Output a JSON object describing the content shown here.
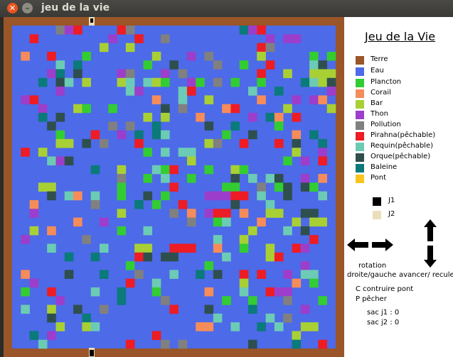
{
  "window": {
    "title": "jeu de la vie",
    "close_icon": "close-icon",
    "minimize_icon": "minimize-icon"
  },
  "panel": {
    "heading": "Jeu de la Vie",
    "legend": [
      {
        "label": "Terre",
        "color": "#9a5529"
      },
      {
        "label": "Eau",
        "color": "#4d6ae8"
      },
      {
        "label": "Plancton",
        "color": "#33cc33"
      },
      {
        "label": "Corail",
        "color": "#f58c5a"
      },
      {
        "label": "Bar",
        "color": "#a8d034"
      },
      {
        "label": "Thon",
        "color": "#9c3ecb"
      },
      {
        "label": "Pollution",
        "color": "#808080"
      },
      {
        "label": "Pirahna(pêchable)",
        "color": "#ee1c24"
      },
      {
        "label": "Requin(pêchable)",
        "color": "#6ccbb4"
      },
      {
        "label": "Orque(pêchable)",
        "color": "#2f4f4f"
      },
      {
        "label": "Baleine",
        "color": "#0a7a7a"
      },
      {
        "label": "Pont",
        "color": "#fac41e"
      }
    ],
    "players": [
      {
        "label": "J1",
        "color": "#000000"
      },
      {
        "label": "J2",
        "color": "#e9dfba"
      }
    ],
    "rotation_label": "rotation",
    "rotation_sub": "droite/gauche",
    "move_label": "avancer/ recule",
    "build_hint": "C contruire pont",
    "fish_hint": "P pêcher",
    "bag_j1": "sac j1 : 0",
    "bag_j2": "sac j2 : 0"
  },
  "grid": {
    "rows": 37,
    "cols": 37,
    "water_color": "#4d6ae8",
    "land_color": "#9a5529",
    "palette": {
      "P": "#33cc33",
      "C": "#f58c5a",
      "B": "#a8d034",
      "T": "#9c3ecb",
      "G": "#808080",
      "R": "#ee1c24",
      "Q": "#6ccbb4",
      "O": "#2f4f4f",
      "L": "#0a7a7a",
      "K": "#000000",
      "J": "#e9dfba"
    },
    "cells": [
      ".....GTR....RG............LTR........",
      "..R........T..R..G...........T.TT....",
      "..........B..B..............RG.......",
      ".C..R...P.......B...T.G.....B.....P.P",
      ".....Q.L.......P..O....G..P..R....QO.",
      "....TL.O....TG...T.G........R..B..BBB",
      "...L.OQ.B...BQ.QBP..TP.G.P..P....LQBO",
      ".....T.......QT....QR......Q..L.....T",
      ".TR.............C..Q..B.....C...T.TC.",
      "...T...BP..P.....O.G....CR.....B....B",
      "...L.O.........B.B...C.....T.LC.R...",
      "....O......G.G..L.....O..L....P.....",
      ".....P...R..T.L.LQ......P..O....C.L.",
      ".....BB.O.G...R.......BG..R...R.O..L",
      ".R.B...........P.Q.QQ...........B..T",
      "....QTO.............B..........P.T.R",
      ".........L..B...QPR...P..BP.........",
      "............G..P.Q..P....O.Q.QO..T.C",
      "...BB.......P.....R.....PP..G.PO.OP.",
      "....O.QC.Q..P..O.P....TTTRR.Q..O...Q",
      "..C......G....L.P..R.....O...Q.....",
      "..T.........B.....G.C.TRR.C..BB..OO.",
      ".......C..T.........G..PQ...C...B.BB",
      "..B.C.......P..Q...........B...Q.O.",
      ".T......G..............Q..B.......R.",
      "....Q.....Q...BB..RRR..C..P..B..RT..",
      "......L..L....RO.OO.....Q....BR.....",
      ".............P........P..........T..",
      ".C....O...L...G...Q..L.O..R.R..T.QQ.",
      "..T..........R..Q.........B.....C.P.",
      ".P..R....Q..L...P.....C...Q..RTT....",
      ".....T......L....G......P..P...G...P",
      ".Q..B..O..G.......R...O....L.....T..",
      "....O...L..............Q.....Q.G....",
      ".....B..BQ...........CC..Q..L.Q..BB.",
      "..L.T...........R...............B...",
      "...Q.........R...G.G.......O....L..R"
    ]
  }
}
